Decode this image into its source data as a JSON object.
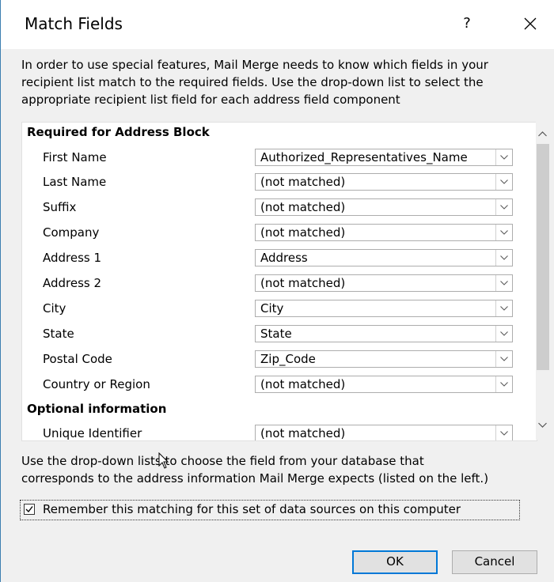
{
  "window": {
    "title": "Match Fields",
    "help_glyph": "?",
    "close_glyph": "✕"
  },
  "intro_lines": [
    "In order to use special features, Mail Merge needs to know which fields in your",
    "recipient list match to the required fields.  Use the drop-down list to select the",
    "appropriate recipient list field for each address field component"
  ],
  "required_section": {
    "heading": "Required for Address Block",
    "rows": [
      {
        "label": "First Name",
        "value": "Authorized_Representatives_Name"
      },
      {
        "label": "Last Name",
        "value": "(not matched)"
      },
      {
        "label": "Suffix",
        "value": "(not matched)"
      },
      {
        "label": "Company",
        "value": "(not matched)"
      },
      {
        "label": "Address 1",
        "value": "Address"
      },
      {
        "label": "Address 2",
        "value": "(not matched)"
      },
      {
        "label": "City",
        "value": "City"
      },
      {
        "label": "State",
        "value": "State"
      },
      {
        "label": "Postal Code",
        "value": "Zip_Code"
      },
      {
        "label": "Country or Region",
        "value": "(not matched)"
      }
    ]
  },
  "optional_section": {
    "heading": "Optional information",
    "rows": [
      {
        "label": "Unique Identifier",
        "value": "(not matched)"
      }
    ]
  },
  "help_lines": [
    "Use the drop-down lists to choose the field from your database that",
    "corresponds to the address information Mail Merge expects (listed on the left.)"
  ],
  "remember": {
    "checked": true,
    "label": "Remember this matching for this set of data sources on this computer"
  },
  "buttons": {
    "ok": "OK",
    "cancel": "Cancel"
  },
  "colors": {
    "accent": "#0078d7",
    "window_border": "#3c7fb1"
  }
}
